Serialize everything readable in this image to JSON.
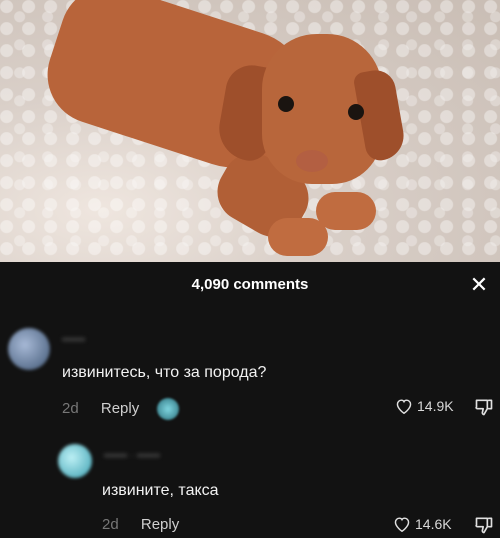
{
  "panel": {
    "title": "4,090 comments",
    "close_icon": "close-icon"
  },
  "comments": [
    {
      "username": "••••••",
      "text": "извинитесь, что за порода?",
      "time": "2d",
      "reply_label": "Reply",
      "likes": "14.9K"
    },
    {
      "username": "•••••• · ••••••",
      "text": "извините, такса",
      "time": "2d",
      "reply_label": "Reply",
      "likes": "14.6K"
    }
  ],
  "colors": {
    "background": "#121212",
    "text": "#f2f2f2",
    "muted": "#777777"
  }
}
